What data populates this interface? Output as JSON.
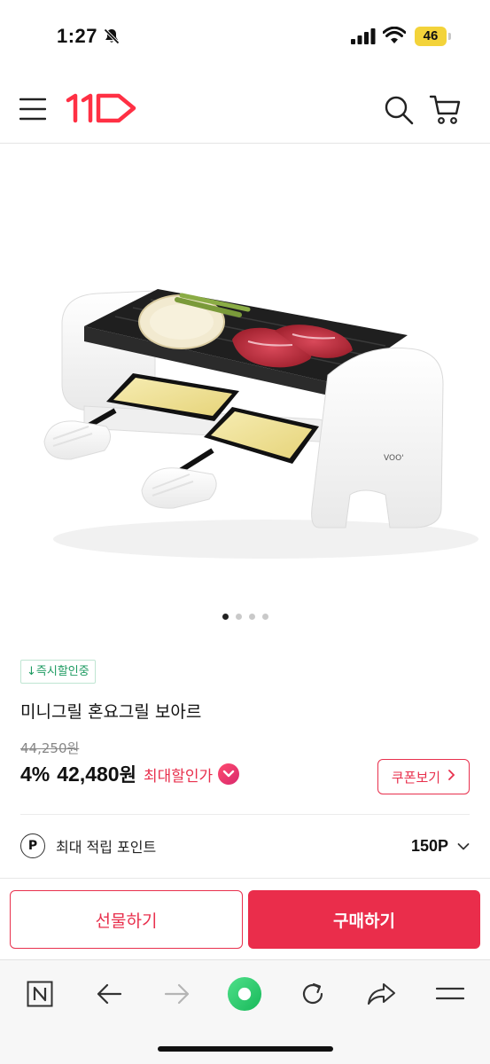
{
  "status_bar": {
    "time": "1:27",
    "battery": "46",
    "colors": {
      "battery": "#f3d33a"
    }
  },
  "header": {
    "logo_text": "11",
    "brand_color": "#ff3044"
  },
  "product": {
    "image_label": "미니그릴 혼요그릴 보아르 제품 이미지",
    "carousel": {
      "total": 4,
      "active": 1
    },
    "badge": "↓즉시할인중",
    "title": "미니그릴 혼요그릴 보아르",
    "original_price": "44,250원",
    "discount_rate": "4%",
    "sale_price": "42,480",
    "currency": "원",
    "max_discount_label": "최대할인가",
    "coupon_button": "쿠폰보기",
    "points_icon": "P",
    "points_label": "최대 적립 포인트",
    "points_value": "150P"
  },
  "actions": {
    "gift_label": "선물하기",
    "buy_label": "구매하기",
    "accent": "#ea2d4b"
  },
  "browser_toolbar": {
    "items": [
      "naver-n-icon",
      "back-arrow-icon",
      "forward-arrow-icon",
      "green-home-icon",
      "reload-icon",
      "share-icon",
      "menu-lines-icon"
    ]
  }
}
